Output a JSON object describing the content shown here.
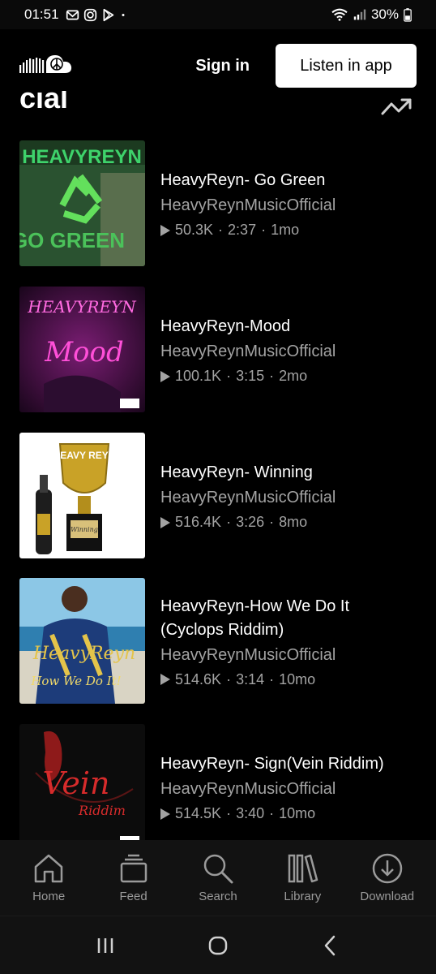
{
  "status_bar": {
    "time": "01:51",
    "battery": "30%",
    "notification_icons": [
      "gmail-icon",
      "instagram-icon",
      "play-store-icon"
    ]
  },
  "header": {
    "logo": "soundcloud-logo",
    "sign_in": "Sign in",
    "listen_in_app": "Listen in app"
  },
  "section": {
    "title_partial": "cial"
  },
  "tracks": [
    {
      "title": "HeavyReyn- Go Green",
      "artist": "HeavyReynMusicOfficial",
      "plays": "50.3K",
      "duration": "2:37",
      "age": "1mo",
      "art_text": "HEAVYREYN",
      "art_sub": "GO GREEN",
      "art_colors": [
        "#1b3b1e",
        "#3ed36b"
      ]
    },
    {
      "title": "HeavyReyn-Mood",
      "artist": "HeavyReynMusicOfficial",
      "plays": "100.1K",
      "duration": "3:15",
      "age": "2mo",
      "art_text": "HEAVYREYN",
      "art_sub": "Mood",
      "art_colors": [
        "#2a0a2c",
        "#ff4fd8"
      ]
    },
    {
      "title": "HeavyReyn- Winning",
      "artist": "HeavyReynMusicOfficial",
      "plays": "516.4K",
      "duration": "3:26",
      "age": "8mo",
      "art_text": "HEAVY REYN",
      "art_sub": "Winning",
      "art_colors": [
        "#ffffff",
        "#c9a227"
      ]
    },
    {
      "title": "HeavyReyn-How We Do It (Cyclops Riddim)",
      "artist": "HeavyReynMusicOfficial",
      "plays": "514.6K",
      "duration": "3:14",
      "age": "10mo",
      "art_text": "HeavyReyn",
      "art_sub": "How We Do It!",
      "art_colors": [
        "#6fb7d8",
        "#e4c44a"
      ]
    },
    {
      "title": "HeavyReyn- Sign(Vein Riddim)",
      "artist": "HeavyReynMusicOfficial",
      "plays": "514.5K",
      "duration": "3:40",
      "age": "10mo",
      "art_text": "Vein",
      "art_sub": "Riddim",
      "art_colors": [
        "#0c0c0c",
        "#d62b2b"
      ]
    }
  ],
  "bottom_nav": {
    "items": [
      {
        "label": "Home",
        "icon": "home-icon"
      },
      {
        "label": "Feed",
        "icon": "feed-icon"
      },
      {
        "label": "Search",
        "icon": "search-icon"
      },
      {
        "label": "Library",
        "icon": "library-icon"
      },
      {
        "label": "Download",
        "icon": "download-icon"
      }
    ]
  },
  "system_nav": [
    "recents-icon",
    "home-button-icon",
    "back-icon"
  ]
}
